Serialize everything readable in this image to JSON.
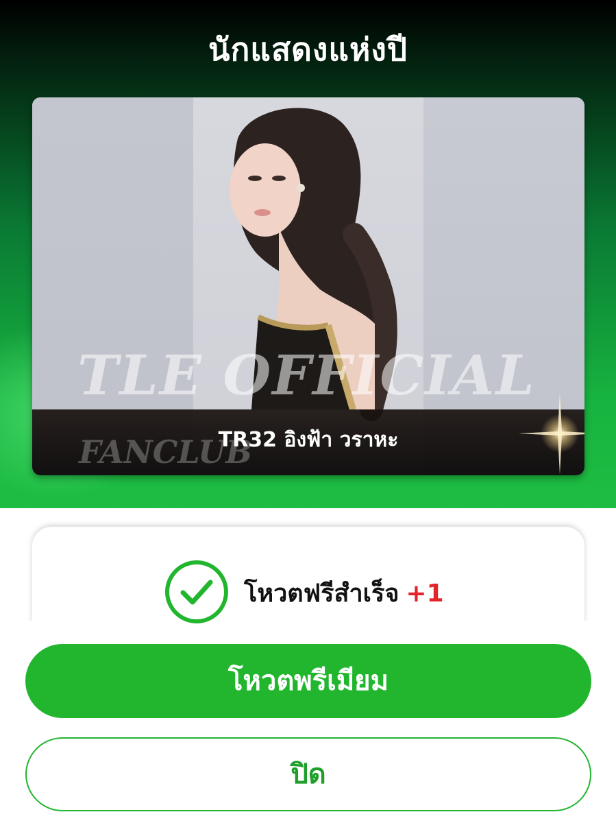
{
  "header": {
    "title": "นักแสดงแห่งปี"
  },
  "candidate": {
    "watermark_main": "TLE OFFICIAL",
    "watermark_sub": "FANCLUB",
    "name": "TR32 อิงฟ้า วราหะ"
  },
  "status": {
    "icon": "check-circle-icon",
    "text": "โหวตฟรีสำเร็จ",
    "plus": "+1"
  },
  "actions": {
    "premium_label": "โหวตพรีเมียม",
    "close_label": "ปิด"
  },
  "colors": {
    "accent_green": "#22b62f",
    "plus_red": "#e3242b"
  }
}
